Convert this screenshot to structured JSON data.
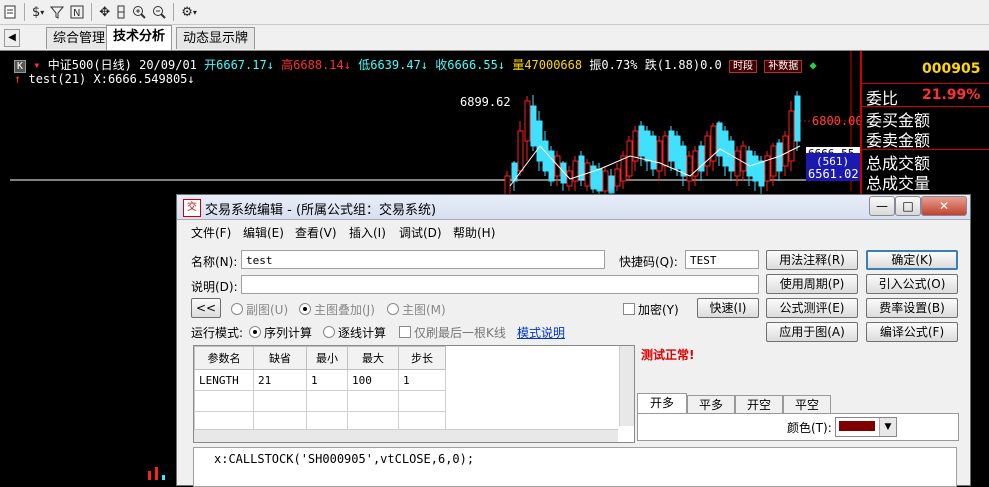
{
  "toolbar": {
    "icons": [
      "document-icon",
      "dollar-icon",
      "filter-icon",
      "formula-icon",
      "move-icon",
      "crosshair-icon",
      "zoom-in-icon",
      "zoom-out-icon",
      "settings-icon"
    ]
  },
  "tabs": {
    "items": [
      {
        "label": "综合管理"
      },
      {
        "label": "技术分析"
      },
      {
        "label": "动态显示牌"
      }
    ],
    "active": "技术分析"
  },
  "chart": {
    "k_badge": "K",
    "info_line": {
      "name": "中证500(日线)",
      "date": "20/09/01",
      "open": "开6667.17",
      "high": "高6688.14",
      "low": "低6639.47",
      "close": "收6666.55",
      "volume": "量47000668",
      "amplitude": "振0.73%",
      "change": "跌(1.88)0.0",
      "period_btn": "时段",
      "fill_btn": "补数据"
    },
    "indicator_line": "test(21) X:6666.549805",
    "labels": {
      "peak": "6899.62",
      "axis_6800": "6800.00",
      "axis_6666": "6666.55",
      "axis_561": "(561)",
      "axis_6561": "6561.02"
    },
    "colors": {
      "up": "#ff2020",
      "down": "#40e0ff",
      "axis": "#ff4040"
    }
  },
  "right_panel": {
    "code": "000905",
    "rows": [
      {
        "label": "委比",
        "value": "21.99%"
      },
      {
        "label": "委买金额",
        "value": ""
      },
      {
        "label": "委卖金额",
        "value": ""
      },
      {
        "label": "总成交额",
        "value": ""
      },
      {
        "label": "总成交量",
        "value": ""
      }
    ]
  },
  "dialog": {
    "title": "交易系统编辑 - (所属公式组：交易系统)",
    "menu": [
      "文件(F)",
      "编辑(E)",
      "查看(V)",
      "插入(I)",
      "调试(D)",
      "帮助(H)"
    ],
    "name_label": "名称(N):",
    "name_value": "test",
    "shortcut_label": "快捷码(Q):",
    "shortcut_value": "TEST",
    "desc_label": "说明(D):",
    "desc_value": "",
    "collapse_btn": "<<",
    "chart_type_options": [
      "副图(U)",
      "主图叠加(J)",
      "主图(M)"
    ],
    "encrypt_label": "加密(Y)",
    "quick_btn": "快速(I)",
    "run_mode_label": "运行模式:",
    "run_mode_options": [
      "序列计算",
      "逐线计算"
    ],
    "refresh_last_label": "仅刷最后一根K线",
    "mode_help_link": "模式说明",
    "test_result": "测试正常!",
    "params": {
      "headers": [
        "参数名",
        "缺省",
        "最小",
        "最大",
        "步长"
      ],
      "rows": [
        [
          "LENGTH",
          "21",
          "1",
          "100",
          "1"
        ]
      ]
    },
    "signal_tabs": [
      "开多",
      "平多",
      "开空",
      "平空"
    ],
    "color_label": "颜色(T):",
    "color_value": "#800000",
    "buttons": {
      "usage_note": "用法注释(R)",
      "confirm": "确定(K)",
      "use_period": "使用周期(P)",
      "import_formula": "引入公式(O)",
      "formula_test": "公式测评(E)",
      "fee_settings": "费率设置(B)",
      "apply_chart": "应用于图(A)",
      "compile": "编译公式(F)"
    },
    "code": "x:CALLSTOCK('SH000905',vtCLOSE,6,0);"
  }
}
